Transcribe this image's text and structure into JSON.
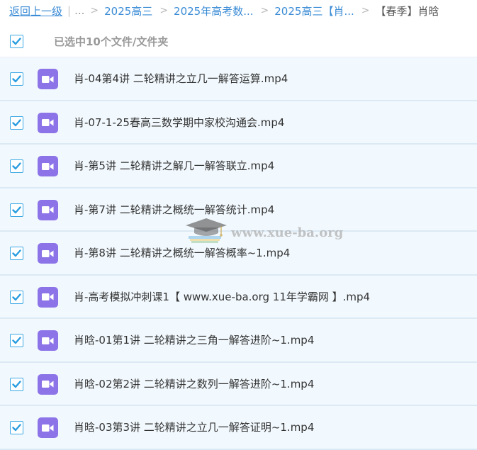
{
  "breadcrumb": {
    "back_label": "返回上一级",
    "separator": "|",
    "ellipsis": "...",
    "arrow": ">",
    "links": [
      "2025高三",
      "2025年高考数...",
      "2025高三【肖..."
    ],
    "current": "【春季】肖晗"
  },
  "selection": {
    "label": "已选中10个文件/文件夹",
    "all_checked": true
  },
  "files": [
    {
      "name": "肖-04第4讲 二轮精讲之立几一解答运算.mp4",
      "checked": true
    },
    {
      "name": "肖-07-1-25春高三数学期中家校沟通会.mp4",
      "checked": true
    },
    {
      "name": "肖-第5讲 二轮精讲之解几一解答联立.mp4",
      "checked": true
    },
    {
      "name": "肖-第7讲 二轮精讲之概统一解答统计.mp4",
      "checked": true
    },
    {
      "name": "肖-第8讲 二轮精讲之概统一解答概率~1.mp4",
      "checked": true
    },
    {
      "name": "肖-高考模拟冲刺课1【 www.xue-ba.org 11年学霸网 】.mp4",
      "checked": true
    },
    {
      "name": "肖晗-01第1讲 二轮精讲之三角一解答进阶~1.mp4",
      "checked": true
    },
    {
      "name": "肖晗-02第2讲 二轮精讲之数列一解答进阶~1.mp4",
      "checked": true
    },
    {
      "name": "肖晗-03第3讲 二轮精讲之立几一解答证明~1.mp4",
      "checked": true
    }
  ],
  "watermark": {
    "text": "www.xue-ba.org",
    "icon": "graduation-cap-icon"
  },
  "icons": {
    "file": "video-file-icon",
    "checkbox": "checkmark-icon"
  },
  "colors": {
    "link": "#3b8cd6",
    "checkbox_border": "#3da8e5",
    "checkmark": "#2a9de0",
    "video_icon_bg": "#8c74e8",
    "row_bg": "#f2f9fe",
    "row_border": "#dbe9f4"
  }
}
